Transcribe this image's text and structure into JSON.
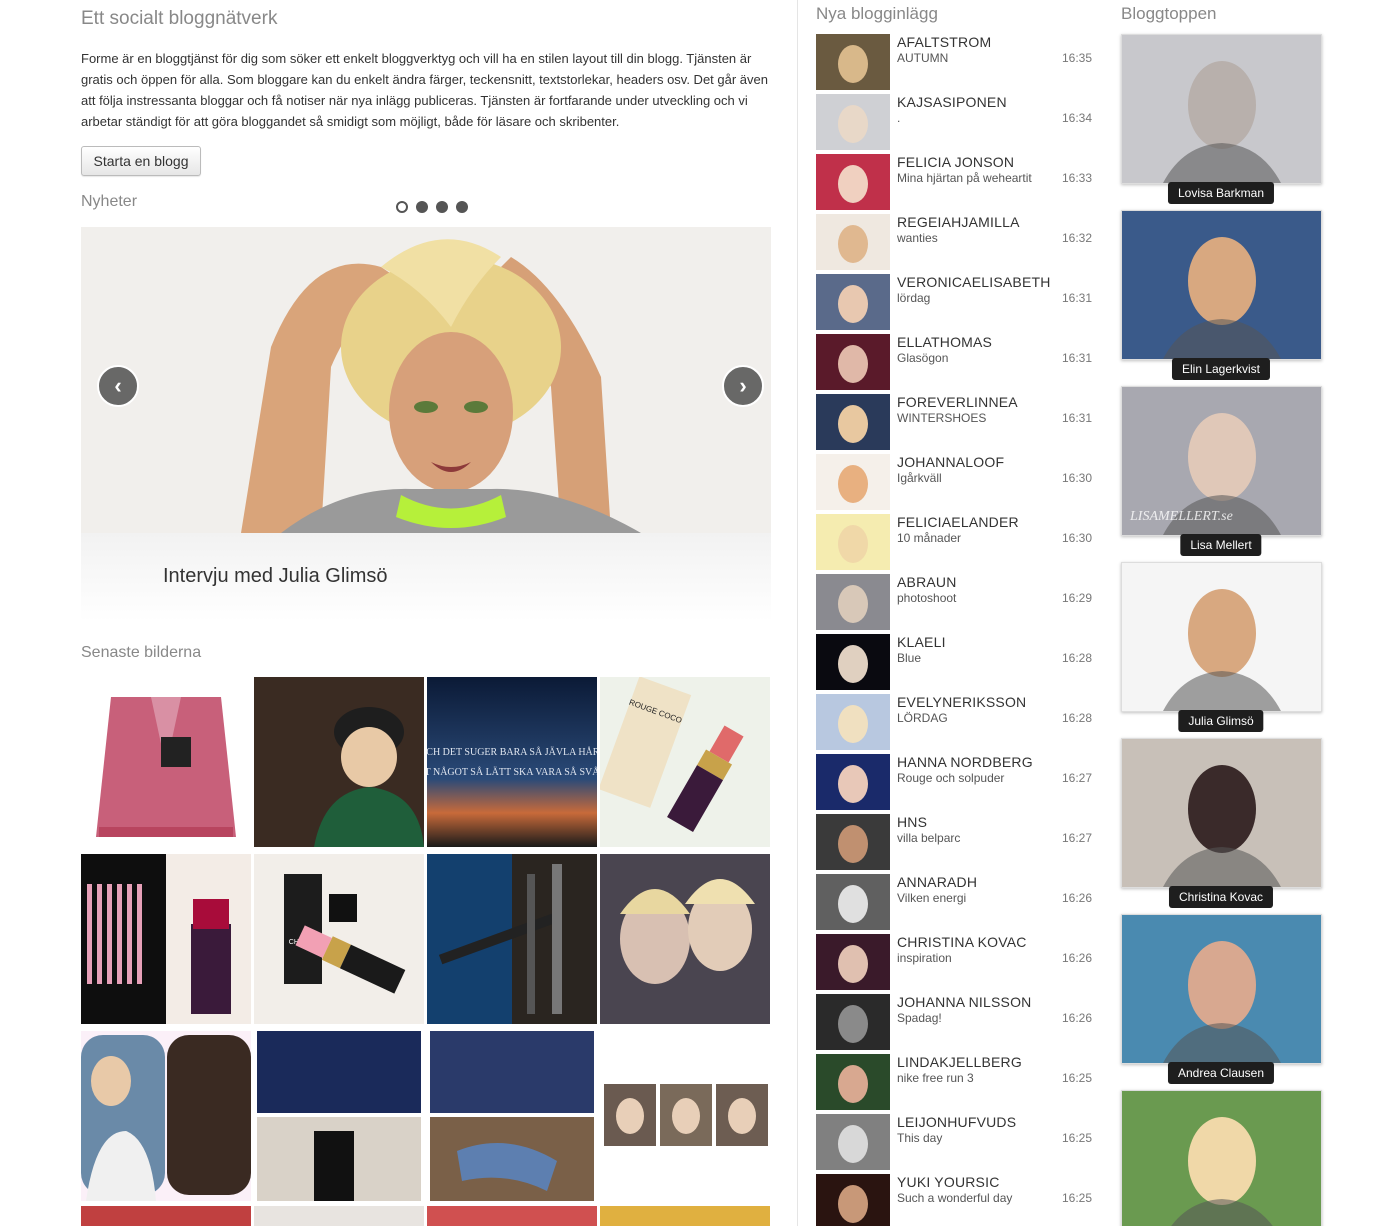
{
  "intro": {
    "title": "Ett socialt bloggnätverk",
    "paragraph": "Forme är en bloggtjänst för dig som söker ett enkelt bloggverktyg och vill ha en stilen layout till din blogg. Tjänsten är gratis och öppen för alla. Som bloggare kan du enkelt ändra färger, teckensnitt, textstorlekar, headers osv. Det går även att följa instressanta bloggar och få notiser när nya inlägg publiceras. Tjänsten är fortfarande under utveckling och vi arbetar ständigt för att göra bloggandet så smidigt som möjligt, både för läsare och skribenter.",
    "start_button": "Starta en blogg"
  },
  "news": {
    "label": "Nyheter",
    "slide_caption": "Intervju med Julia Glimsö",
    "prev_icon": "chevron-left-icon",
    "next_icon": "chevron-right-icon",
    "dots_total": 4,
    "active_dot": 1
  },
  "latest_photos": {
    "label": "Senaste bilderna",
    "image_texts": {
      "quote_line1": "OCH DET SUGER BARA SÅ JÄVLA HÅRT",
      "quote_line2": "ATT NÅGOT SÅ LÄTT SKA VARA SÅ SVÅRT",
      "lipstick_brand": "ROUGE COCO",
      "chanel": "CHANEL"
    }
  },
  "feed": {
    "title": "Nya blogginlägg",
    "items": [
      {
        "name": "AFALTSTROM",
        "post": "AUTUMN",
        "time": "16:35"
      },
      {
        "name": "KAJSASIPONEN",
        "post": ".",
        "time": "16:34"
      },
      {
        "name": "FELICIA JONSON",
        "post": "Mina hjärtan på weheartit",
        "time": "16:33"
      },
      {
        "name": "REGEIAHJAMILLA",
        "post": "wanties",
        "time": "16:32"
      },
      {
        "name": "VERONICAELISABETH",
        "post": "lördag",
        "time": "16:31"
      },
      {
        "name": "ELLATHOMAS",
        "post": "Glasögon",
        "time": "16:31"
      },
      {
        "name": "FOREVERLINNEA",
        "post": "WINTERSHOES",
        "time": "16:31"
      },
      {
        "name": "JOHANNALOOF",
        "post": "Igårkväll",
        "time": "16:30"
      },
      {
        "name": "FELICIAELANDER",
        "post": "10 månader",
        "time": "16:30"
      },
      {
        "name": "ABRAUN",
        "post": "photoshoot",
        "time": "16:29"
      },
      {
        "name": "KLAELI",
        "post": "Blue",
        "time": "16:28"
      },
      {
        "name": "EVELYNERIKSSON",
        "post": "LÖRDAG",
        "time": "16:28"
      },
      {
        "name": "HANNA NORDBERG",
        "post": "Rouge och solpuder",
        "time": "16:27"
      },
      {
        "name": "HNS",
        "post": "villa belparc",
        "time": "16:27"
      },
      {
        "name": "ANNARADH",
        "post": "Vilken energi",
        "time": "16:26"
      },
      {
        "name": "CHRISTINA KOVAC",
        "post": "inspiration",
        "time": "16:26"
      },
      {
        "name": "JOHANNA NILSSON",
        "post": "Spadag!",
        "time": "16:26"
      },
      {
        "name": "LINDAKJELLBERG",
        "post": "nike free run 3",
        "time": "16:25"
      },
      {
        "name": "LEIJONHUFVUDS",
        "post": "This day",
        "time": "16:25"
      },
      {
        "name": "YUKI YOURSIC",
        "post": "Such a wonderful day",
        "time": "16:25"
      }
    ]
  },
  "top": {
    "title": "Bloggtoppen",
    "items": [
      {
        "name": "Lovisa Barkman"
      },
      {
        "name": "Elin Lagerkvist"
      },
      {
        "name": "Lisa Mellert",
        "watermark": "LISAMELLERT.se"
      },
      {
        "name": "Julia Glimsö"
      },
      {
        "name": "Christina Kovac"
      },
      {
        "name": "Andrea Clausen"
      },
      {
        "name": ""
      }
    ]
  }
}
